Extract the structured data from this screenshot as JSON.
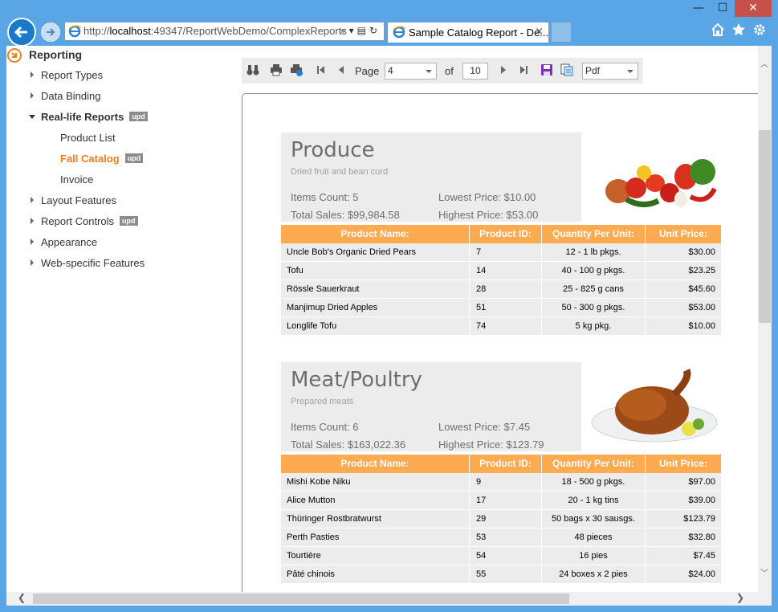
{
  "browser": {
    "url_prefix": "http://",
    "url_host": "localhost",
    "url_rest": ":49347/ReportWebDemo/ComplexReports",
    "tab_title": "Sample Catalog Report - De...",
    "tab_close": "×",
    "minimize": "—",
    "maximize": "☐",
    "close": "✕"
  },
  "sidebar": {
    "root_label": "Reporting",
    "items": [
      {
        "label": "Report Types"
      },
      {
        "label": "Data Binding"
      },
      {
        "label": "Real-life Reports",
        "badge": "upd"
      },
      {
        "label": "Product List"
      },
      {
        "label": "Fall Catalog",
        "badge": "upd"
      },
      {
        "label": "Invoice"
      },
      {
        "label": "Layout Features"
      },
      {
        "label": "Report Controls",
        "badge": "upd"
      },
      {
        "label": "Appearance"
      },
      {
        "label": "Web-specific Features"
      }
    ]
  },
  "toolbar": {
    "page_label": "Page",
    "page_value": "4",
    "of_label": "of",
    "total_pages": "10",
    "format_value": "Pdf"
  },
  "report": {
    "columns": [
      "Product Name:",
      "Product ID:",
      "Quantity Per Unit:",
      "Unit Price:"
    ],
    "categories": [
      {
        "name": "Produce",
        "description": "Dried fruit and bean curd",
        "items_count": "Items Count: 5",
        "lowest_price": "Lowest Price: $10.00",
        "total_sales": "Total Sales: $99,984.58",
        "highest_price": "Highest Price: $53.00",
        "image": "vegetables-image",
        "rows": [
          [
            "Uncle Bob's Organic Dried Pears",
            "7",
            "12 - 1 lb pkgs.",
            "$30.00"
          ],
          [
            "Tofu",
            "14",
            "40 - 100 g pkgs.",
            "$23.25"
          ],
          [
            "Rössle Sauerkraut",
            "28",
            "25 - 825 g cans",
            "$45.60"
          ],
          [
            "Manjimup Dried Apples",
            "51",
            "50 - 300 g pkgs.",
            "$53.00"
          ],
          [
            "Longlife Tofu",
            "74",
            "5 kg pkg.",
            "$10.00"
          ]
        ]
      },
      {
        "name": "Meat/Poultry",
        "description": "Prepared meats",
        "items_count": "Items Count: 6",
        "lowest_price": "Lowest Price: $7.45",
        "total_sales": "Total Sales: $163,022.36",
        "highest_price": "Highest Price: $123.79",
        "image": "roast-chicken-image",
        "rows": [
          [
            "Mishi Kobe Niku",
            "9",
            "18 - 500 g pkgs.",
            "$97.00"
          ],
          [
            "Alice Mutton",
            "17",
            "20 - 1 kg tins",
            "$39.00"
          ],
          [
            "Thüringer Rostbratwurst",
            "29",
            "50 bags x 30 sausgs.",
            "$123.79"
          ],
          [
            "Perth Pasties",
            "53",
            "48 pieces",
            "$32.80"
          ],
          [
            "Tourtière",
            "54",
            "16 pies",
            "$7.45"
          ],
          [
            "Pâté chinois",
            "55",
            "24 boxes x 2 pies",
            "$24.00"
          ]
        ]
      }
    ]
  },
  "colors": {
    "accent_orange": "#f07e1d",
    "table_header": "#fdaa51",
    "row_bg": "#ececec",
    "badge_bg": "#8c8c8c",
    "browser_chrome": "#5aa5e6"
  }
}
